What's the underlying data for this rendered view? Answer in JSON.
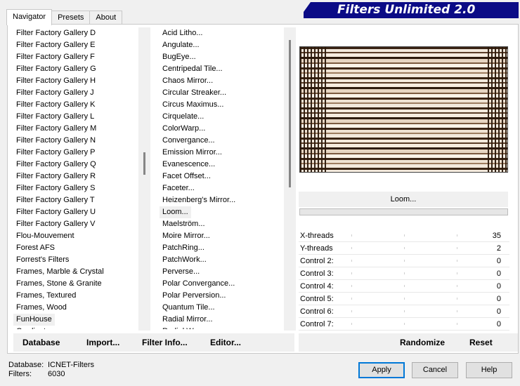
{
  "tabs": [
    "Navigator",
    "Presets",
    "About"
  ],
  "banner": "Filters Unlimited 2.0",
  "categories": [
    "Filter Factory Gallery D",
    "Filter Factory Gallery E",
    "Filter Factory Gallery F",
    "Filter Factory Gallery G",
    "Filter Factory Gallery H",
    "Filter Factory Gallery J",
    "Filter Factory Gallery K",
    "Filter Factory Gallery L",
    "Filter Factory Gallery M",
    "Filter Factory Gallery N",
    "Filter Factory Gallery P",
    "Filter Factory Gallery Q",
    "Filter Factory Gallery R",
    "Filter Factory Gallery S",
    "Filter Factory Gallery T",
    "Filter Factory Gallery U",
    "Filter Factory Gallery V",
    "Flou-Mouvement",
    "Forest AFS",
    "Forrest's Filters",
    "Frames, Marble & Crystal",
    "Frames, Stone & Granite",
    "Frames, Textured",
    "Frames, Wood",
    "FunHouse",
    "Gradient"
  ],
  "selected_category": "FunHouse",
  "filters": [
    "Acid Litho...",
    "Angulate...",
    "BugEye...",
    "Centripedal Tile...",
    "Chaos Mirror...",
    "Circular Streaker...",
    "Circus Maximus...",
    "Cirquelate...",
    "ColorWarp...",
    "Convergance...",
    "Emission Mirror...",
    "Evanescence...",
    "Facet Offset...",
    "Faceter...",
    "Heizenberg's Mirror...",
    "Loom...",
    "Maelström...",
    "Moire Mirror...",
    "PatchRing...",
    "PatchWork...",
    "Perverse...",
    "Polar Convergance...",
    "Polar Perversion...",
    "Quantum Tile...",
    "Radial Mirror...",
    "Radial Weave..."
  ],
  "selected_filter": "Loom...",
  "preview_filter_name": "Loom...",
  "controls": [
    {
      "label": "X-threads",
      "value": "35"
    },
    {
      "label": "Y-threads",
      "value": "2"
    },
    {
      "label": "Control 2:",
      "value": "0"
    },
    {
      "label": "Control 3:",
      "value": "0"
    },
    {
      "label": "Control 4:",
      "value": "0"
    },
    {
      "label": "Control 5:",
      "value": "0"
    },
    {
      "label": "Control 6:",
      "value": "0"
    },
    {
      "label": "Control 7:",
      "value": "0"
    }
  ],
  "left_buttons": {
    "database": "Database",
    "import": "Import...",
    "filter_info": "Filter Info...",
    "editor": "Editor..."
  },
  "right_buttons": {
    "randomize": "Randomize",
    "reset": "Reset"
  },
  "status": {
    "database_label": "Database:",
    "database_value": "ICNET-Filters",
    "filters_label": "Filters:",
    "filters_value": "6030"
  },
  "dialog_buttons": {
    "apply": "Apply",
    "cancel": "Cancel",
    "help": "Help"
  },
  "colors": {
    "banner_bg": "#0b0b86",
    "default_button_border": "#0078d7",
    "weave_dark": "#3a2414",
    "weave_light": "#f3e9dc"
  }
}
